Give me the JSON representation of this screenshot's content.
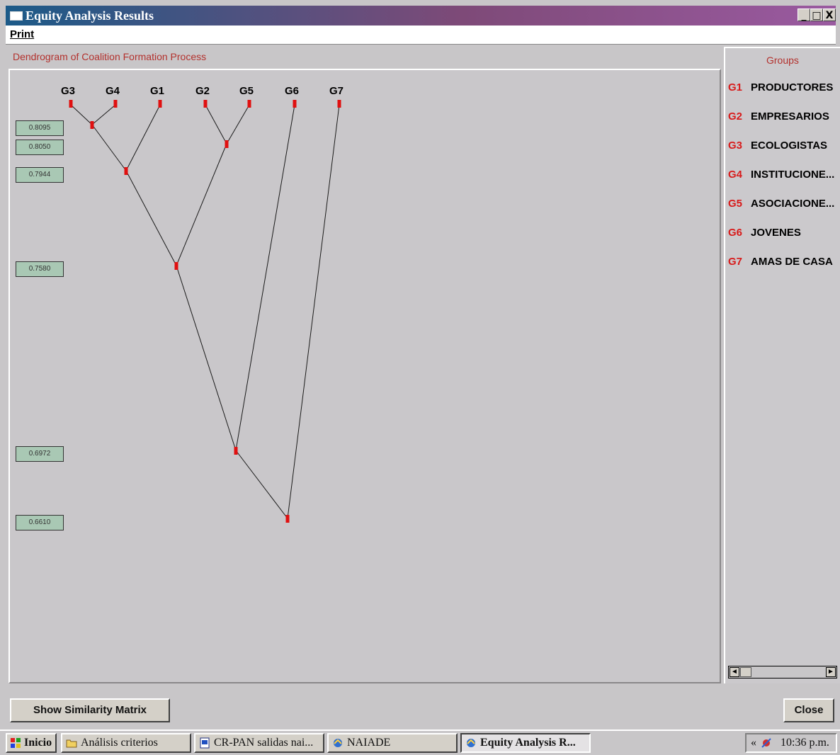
{
  "window": {
    "title": "Equity Analysis Results",
    "controls": [
      "_",
      "□",
      "X"
    ]
  },
  "menu": {
    "print_label": "Print"
  },
  "dendrogram": {
    "title": "Dendrogram of Coalition Formation Process",
    "leaf_labels": [
      "G3",
      "G4",
      "G1",
      "G2",
      "G5",
      "G6",
      "G7"
    ],
    "similarity_levels": [
      "0.8095",
      "0.8050",
      "0.7944",
      "0.7580",
      "0.6972",
      "0.6610"
    ],
    "line_color": "#1a1a1a",
    "node_color": "#e01010"
  },
  "groups": {
    "title": "Groups",
    "items": [
      {
        "code": "G1",
        "name": "PRODUCTORES"
      },
      {
        "code": "G2",
        "name": "EMPRESARIOS"
      },
      {
        "code": "G3",
        "name": "ECOLOGISTAS"
      },
      {
        "code": "G4",
        "name": "INSTITUCIONE..."
      },
      {
        "code": "G5",
        "name": "ASOCIACIONE..."
      },
      {
        "code": "G6",
        "name": "JOVENES"
      },
      {
        "code": "G7",
        "name": "AMAS DE CASA"
      }
    ]
  },
  "buttons": {
    "similarity_matrix": "Show Similarity Matrix",
    "close": "Close"
  },
  "taskbar": {
    "start": "Inicio",
    "tasks": [
      "Análisis criterios",
      "CR-PAN salidas nai...",
      "NAIADE",
      "Equity Analysis R..."
    ],
    "tray_arrows": "«",
    "clock": "10:36 p.m."
  }
}
